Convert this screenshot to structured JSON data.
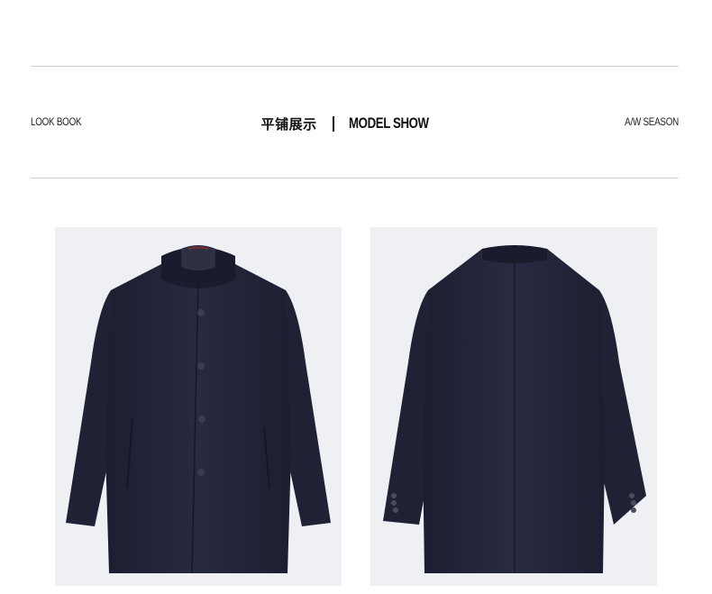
{
  "header": {
    "left_label": "LOOK BOOK",
    "center_cn": "平铺展示",
    "center_en": "MODEL SHOW",
    "right_label": "A/W SEASON"
  },
  "products": [
    {
      "view": "front",
      "icon": "coat-front-icon"
    },
    {
      "view": "back",
      "icon": "coat-back-icon"
    }
  ],
  "colors": {
    "coat": "#23253a",
    "photo_background": "#eff0f3",
    "rule": "#cfcfcf"
  }
}
